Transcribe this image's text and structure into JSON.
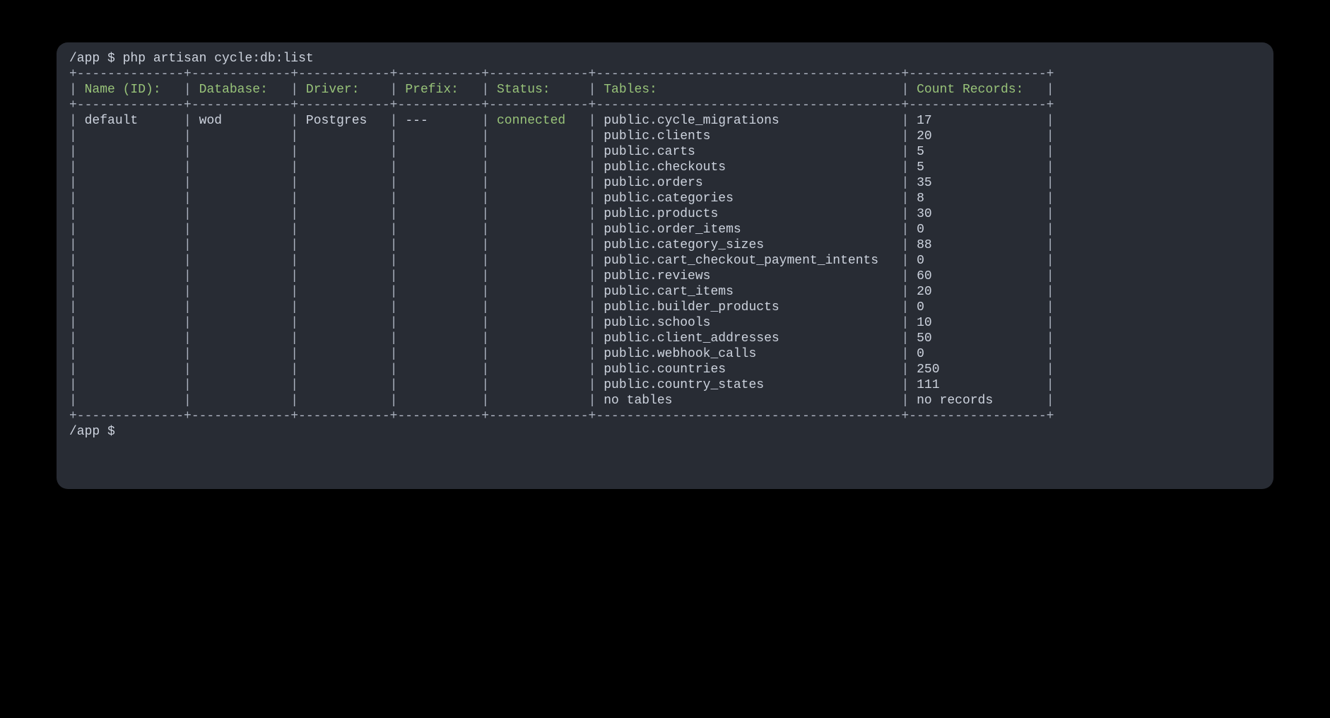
{
  "prompt_path": "/app $ ",
  "command": "php artisan cycle:db:list",
  "headers": {
    "name": "Name (ID):",
    "database": "Database:",
    "driver": "Driver:",
    "prefix": "Prefix:",
    "status": "Status:",
    "tables": "Tables:",
    "count": "Count Records:"
  },
  "row": {
    "name": "default",
    "database": "wod",
    "driver": "Postgres",
    "prefix": "---",
    "status": "connected"
  },
  "tables": [
    {
      "table": "public.cycle_migrations",
      "count": "17"
    },
    {
      "table": "public.clients",
      "count": "20"
    },
    {
      "table": "public.carts",
      "count": "5"
    },
    {
      "table": "public.checkouts",
      "count": "5"
    },
    {
      "table": "public.orders",
      "count": "35"
    },
    {
      "table": "public.categories",
      "count": "8"
    },
    {
      "table": "public.products",
      "count": "30"
    },
    {
      "table": "public.order_items",
      "count": "0"
    },
    {
      "table": "public.category_sizes",
      "count": "88"
    },
    {
      "table": "public.cart_checkout_payment_intents",
      "count": "0"
    },
    {
      "table": "public.reviews",
      "count": "60"
    },
    {
      "table": "public.cart_items",
      "count": "20"
    },
    {
      "table": "public.builder_products",
      "count": "0"
    },
    {
      "table": "public.schools",
      "count": "10"
    },
    {
      "table": "public.client_addresses",
      "count": "50"
    },
    {
      "table": "public.webhook_calls",
      "count": "0"
    },
    {
      "table": "public.countries",
      "count": "250"
    },
    {
      "table": "public.country_states",
      "count": "111"
    },
    {
      "table": "no tables",
      "count": "no records"
    }
  ],
  "col_widths": {
    "name": 12,
    "database": 11,
    "driver": 10,
    "prefix": 9,
    "status": 11,
    "tables": 38,
    "count": 16
  }
}
